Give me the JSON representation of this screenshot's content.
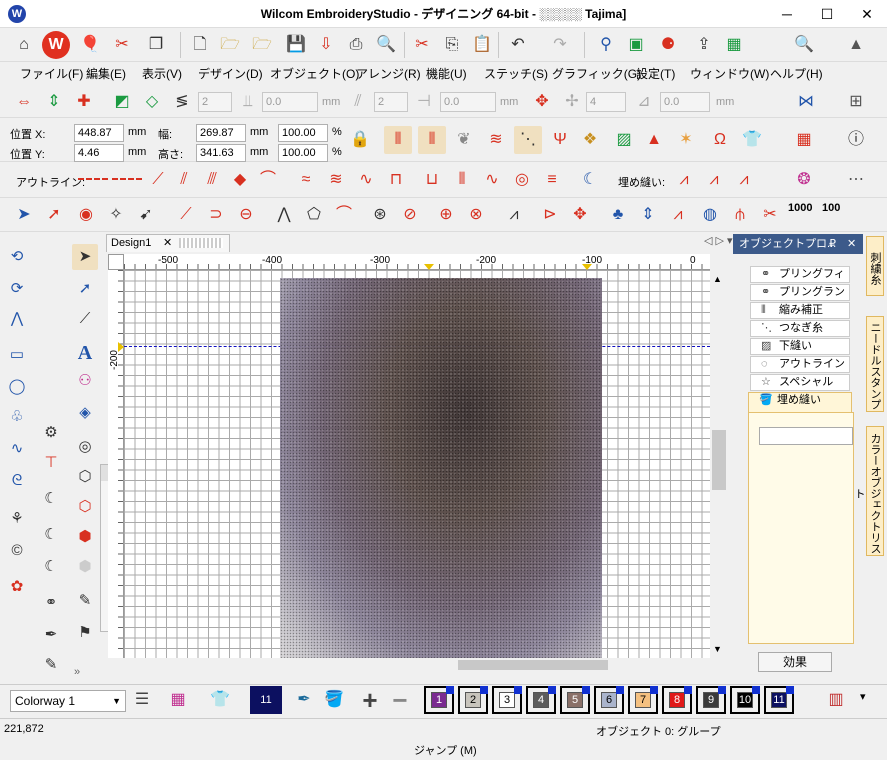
{
  "window": {
    "title": "Wilcom EmbroideryStudio - デザイニング 64-bit - ░░░░░ Tajima]",
    "minimize": "─",
    "maximize": "☐",
    "close": "✕"
  },
  "menu": [
    "ファイル(F)",
    "編集(E)",
    "表示(V)",
    "デザイン(D)",
    "オブジェクト(O)",
    "アレンジ(R)",
    "機能(U)",
    "ステッチ(S)",
    "グラフィック(G)",
    "設定(T)",
    "ウィンドウ(W)",
    "ヘルプ(H)"
  ],
  "toolbar_arrange": {
    "spin1": "2",
    "spin2": "0.0",
    "unit_mm1": "mm",
    "spin3": "2",
    "spin4": "0.0",
    "unit_mm2": "mm",
    "spin5": "4",
    "spin6": "0.0",
    "unit_mm3": "mm"
  },
  "properties": {
    "pos_x_label": "位置 X:",
    "pos_x": "448.87",
    "unit1": "mm",
    "pos_y_label": "位置 Y:",
    "pos_y": "4.46",
    "unit2": "mm",
    "width_label": "幅:",
    "width": "269.87",
    "unit3": "mm",
    "height_label": "高さ:",
    "height": "341.63",
    "unit4": "mm",
    "scale_w": "100.00",
    "pct1": "%",
    "scale_h": "100.00",
    "pct2": "%"
  },
  "outline_label": "アウトライン:",
  "fill_label": "埋め縫い:",
  "stitch_numbers": [
    "1000",
    "100"
  ],
  "document_tab": {
    "label": "Design1",
    "close": "✕"
  },
  "ruler": {
    "top_ticks": [
      "-500",
      "-400",
      "-300",
      "-200",
      "-100",
      "0"
    ],
    "left_ticks": [
      "-200"
    ]
  },
  "object_panel": {
    "title": "オブジェクトプロ...",
    "pin": "₽",
    "close": "✕",
    "tabs": [
      "プリングフィル",
      "プリングランニ...",
      "縮み補正",
      "つなぎ糸",
      "下縫い",
      "アウトライン",
      "スペシャル",
      "埋め縫い"
    ],
    "effect_button": "効果"
  },
  "side_tabs": [
    "刺繍糸",
    "ニードルスタンプ",
    "カラーオブジェクトリスト"
  ],
  "floating_toolbar": {
    "close": "✕",
    "labels": [
      "1",
      "3"
    ]
  },
  "colorway": {
    "selected": "Colorway 1"
  },
  "current_color": "11",
  "palette": [
    {
      "num": "1",
      "color": "#7a2a90"
    },
    {
      "num": "2",
      "color": "#c8c4bc"
    },
    {
      "num": "3",
      "color": "#ffffff"
    },
    {
      "num": "4",
      "color": "#5c5c5c"
    },
    {
      "num": "5",
      "color": "#8a7068"
    },
    {
      "num": "6",
      "color": "#aab4cc"
    },
    {
      "num": "7",
      "color": "#f4c080"
    },
    {
      "num": "8",
      "color": "#e01818"
    },
    {
      "num": "9",
      "color": "#3a3a3a"
    },
    {
      "num": "10",
      "color": "#000000"
    },
    {
      "num": "11",
      "color": "#0c1060"
    }
  ],
  "status": {
    "coords": "221,872",
    "object": "オブジェクト 0: グループ",
    "mode": "ジャンプ (M)"
  },
  "icons": [
    "home-icon",
    "wilcom-icon",
    "balloon-icon",
    "magic-icon",
    "open-folder-icon",
    "new-icon",
    "save-icon",
    "print-icon",
    "cut-icon",
    "copy-icon",
    "paste-icon",
    "undo-icon",
    "redo-icon",
    "zoom-icon",
    "info-icon"
  ]
}
